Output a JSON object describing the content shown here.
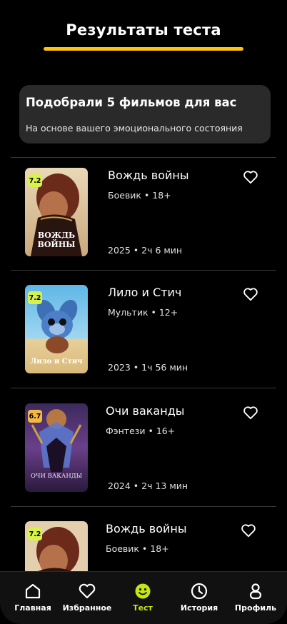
{
  "header": {
    "title": "Результаты теста"
  },
  "summary_card": {
    "title": "Подобрали 5 фильмов для вас",
    "subtitle": "На основе вашего эмоционального состояния"
  },
  "movies": [
    {
      "title": "Вождь войны",
      "genre": "Боевик • 18+",
      "meta": "2025 • 2ч 6 мин",
      "rating": "7.2",
      "rating_color": "#D7F24A",
      "poster_text": "ВОЖДЬ ВОЙНЫ",
      "favorite_icon": "heart-outline-icon"
    },
    {
      "title": "Лило и Стич",
      "genre": "Мультик • 12+",
      "meta": "2023 • 1ч 56 мин",
      "rating": "7.2",
      "rating_color": "#D7F24A",
      "poster_text": "Лило и Стич",
      "favorite_icon": "heart-outline-icon"
    },
    {
      "title": "Очи ваканды",
      "genre": "Фэнтези • 16+",
      "meta": "2024 • 2ч 13 мин",
      "rating": "6.7",
      "rating_color": "#F5B942",
      "poster_text": "ОЧИ ВАКАНДЫ",
      "favorite_icon": "heart-outline-icon"
    },
    {
      "title": "Вождь войны",
      "genre": "Боевик • 18+",
      "meta": "",
      "rating": "7.2",
      "rating_color": "#D7F24A",
      "poster_text": "",
      "favorite_icon": "heart-outline-icon"
    }
  ],
  "nav": {
    "items": [
      {
        "label": "Главная",
        "icon": "home-icon",
        "active": false
      },
      {
        "label": "Избранное",
        "icon": "heart-icon",
        "active": false
      },
      {
        "label": "Тест",
        "icon": "smiley-icon",
        "active": true
      },
      {
        "label": "История",
        "icon": "clock-icon",
        "active": false
      },
      {
        "label": "Профиль",
        "icon": "person-icon",
        "active": false
      }
    ],
    "active_color": "#C5E80C"
  },
  "colors": {
    "accent": "#FFC20E",
    "background": "#000000",
    "card": "#2A2A2A"
  }
}
